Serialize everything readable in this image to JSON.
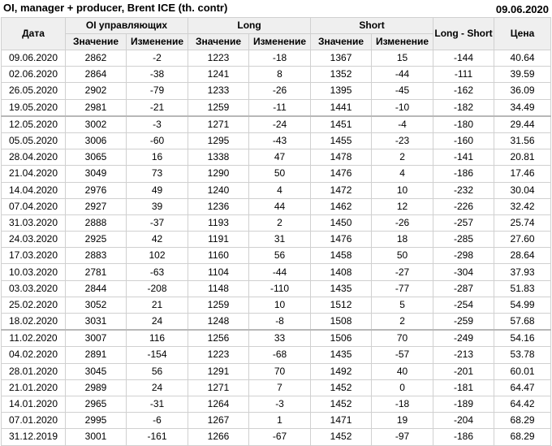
{
  "header": {
    "title": "OI, manager + producer, Brent ICE (th. contr)",
    "date": "09.06.2020"
  },
  "table": {
    "col_date": "Дата",
    "group_oi": "OI управляющих",
    "group_long": "Long",
    "group_short": "Short",
    "col_ls": "Long - Short",
    "col_price": "Цена",
    "sub_value": "Значение",
    "sub_change": "Изменение",
    "rows": [
      [
        "09.06.2020",
        "2862",
        "-2",
        "1223",
        "-18",
        "1367",
        "15",
        "-144",
        "40.64"
      ],
      [
        "02.06.2020",
        "2864",
        "-38",
        "1241",
        "8",
        "1352",
        "-44",
        "-111",
        "39.59"
      ],
      [
        "26.05.2020",
        "2902",
        "-79",
        "1233",
        "-26",
        "1395",
        "-45",
        "-162",
        "36.09"
      ],
      [
        "19.05.2020",
        "2981",
        "-21",
        "1259",
        "-11",
        "1441",
        "-10",
        "-182",
        "34.49"
      ],
      [
        "12.05.2020",
        "3002",
        "-3",
        "1271",
        "-24",
        "1451",
        "-4",
        "-180",
        "29.44"
      ],
      [
        "05.05.2020",
        "3006",
        "-60",
        "1295",
        "-43",
        "1455",
        "-23",
        "-160",
        "31.56"
      ],
      [
        "28.04.2020",
        "3065",
        "16",
        "1338",
        "47",
        "1478",
        "2",
        "-141",
        "20.81"
      ],
      [
        "21.04.2020",
        "3049",
        "73",
        "1290",
        "50",
        "1476",
        "4",
        "-186",
        "17.46"
      ],
      [
        "14.04.2020",
        "2976",
        "49",
        "1240",
        "4",
        "1472",
        "10",
        "-232",
        "30.04"
      ],
      [
        "07.04.2020",
        "2927",
        "39",
        "1236",
        "44",
        "1462",
        "12",
        "-226",
        "32.42"
      ],
      [
        "31.03.2020",
        "2888",
        "-37",
        "1193",
        "2",
        "1450",
        "-26",
        "-257",
        "25.74"
      ],
      [
        "24.03.2020",
        "2925",
        "42",
        "1191",
        "31",
        "1476",
        "18",
        "-285",
        "27.60"
      ],
      [
        "17.03.2020",
        "2883",
        "102",
        "1160",
        "56",
        "1458",
        "50",
        "-298",
        "28.64"
      ],
      [
        "10.03.2020",
        "2781",
        "-63",
        "1104",
        "-44",
        "1408",
        "-27",
        "-304",
        "37.93"
      ],
      [
        "03.03.2020",
        "2844",
        "-208",
        "1148",
        "-110",
        "1435",
        "-77",
        "-287",
        "51.83"
      ],
      [
        "25.02.2020",
        "3052",
        "21",
        "1259",
        "10",
        "1512",
        "5",
        "-254",
        "54.99"
      ],
      [
        "18.02.2020",
        "3031",
        "24",
        "1248",
        "-8",
        "1508",
        "2",
        "-259",
        "57.68"
      ],
      [
        "11.02.2020",
        "3007",
        "116",
        "1256",
        "33",
        "1506",
        "70",
        "-249",
        "54.16"
      ],
      [
        "04.02.2020",
        "2891",
        "-154",
        "1223",
        "-68",
        "1435",
        "-57",
        "-213",
        "53.78"
      ],
      [
        "28.01.2020",
        "3045",
        "56",
        "1291",
        "70",
        "1492",
        "40",
        "-201",
        "60.01"
      ],
      [
        "21.01.2020",
        "2989",
        "24",
        "1271",
        "7",
        "1452",
        "0",
        "-181",
        "64.47"
      ],
      [
        "14.01.2020",
        "2965",
        "-31",
        "1264",
        "-3",
        "1452",
        "-18",
        "-189",
        "64.42"
      ],
      [
        "07.01.2020",
        "2995",
        "-6",
        "1267",
        "1",
        "1471",
        "19",
        "-204",
        "68.29"
      ],
      [
        "31.12.2019",
        "3001",
        "-161",
        "1266",
        "-67",
        "1452",
        "-97",
        "-186",
        "68.29"
      ]
    ]
  }
}
